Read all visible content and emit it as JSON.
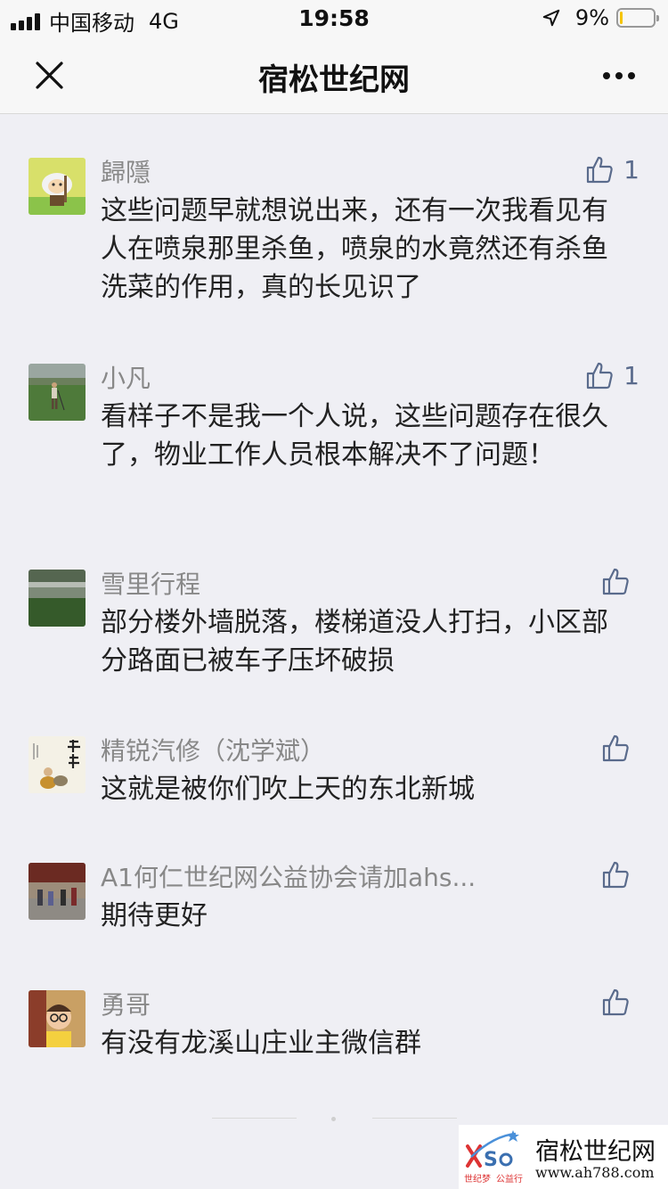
{
  "status_bar": {
    "carrier": "中国移动",
    "network": "4G",
    "time": "19:58",
    "battery_percent": "9%",
    "battery_level": 0.09
  },
  "nav": {
    "title": "宿松世纪网"
  },
  "comments": [
    {
      "name": "歸隱",
      "text": "这些问题早就想说出来，还有一次我看见有人在喷泉那里杀鱼，喷泉的水竟然还有杀鱼洗菜的作用，真的长见识了",
      "likes": "1",
      "avatar_icon": "cartoon-sheep-avatar"
    },
    {
      "name": "小凡",
      "text": "看样子不是我一个人说，这些问题存在很久了，物业工作人员根本解决不了问题！",
      "likes": "1",
      "avatar_icon": "golf-field-photo-avatar"
    },
    {
      "name": "雪里行程",
      "text": "部分楼外墙脱落，楼梯道没人打扫，小区部分路面已被车子压坏破损",
      "likes": "",
      "avatar_icon": "foggy-field-photo-avatar"
    },
    {
      "name": "精锐汽修（沈学斌）",
      "text": "这就是被你们吹上天的东北新城",
      "likes": "",
      "avatar_icon": "calligraphy-painting-avatar"
    },
    {
      "name": "A1何仁世纪网公益协会请加ahs...",
      "text": "期待更好",
      "likes": "",
      "avatar_icon": "street-photo-avatar"
    },
    {
      "name": "勇哥",
      "text": "有没有龙溪山庄业主微信群",
      "likes": "",
      "avatar_icon": "child-photo-avatar"
    }
  ],
  "watermark": {
    "title": "宿松世纪网",
    "url": "www.ah788.com",
    "logo_sub1": "世纪梦",
    "logo_sub2": "公益行"
  },
  "colors": {
    "background": "#efeff4",
    "name_gray": "#888888",
    "like_blue": "#5a6b8c",
    "battery_yellow": "#f5c400"
  }
}
